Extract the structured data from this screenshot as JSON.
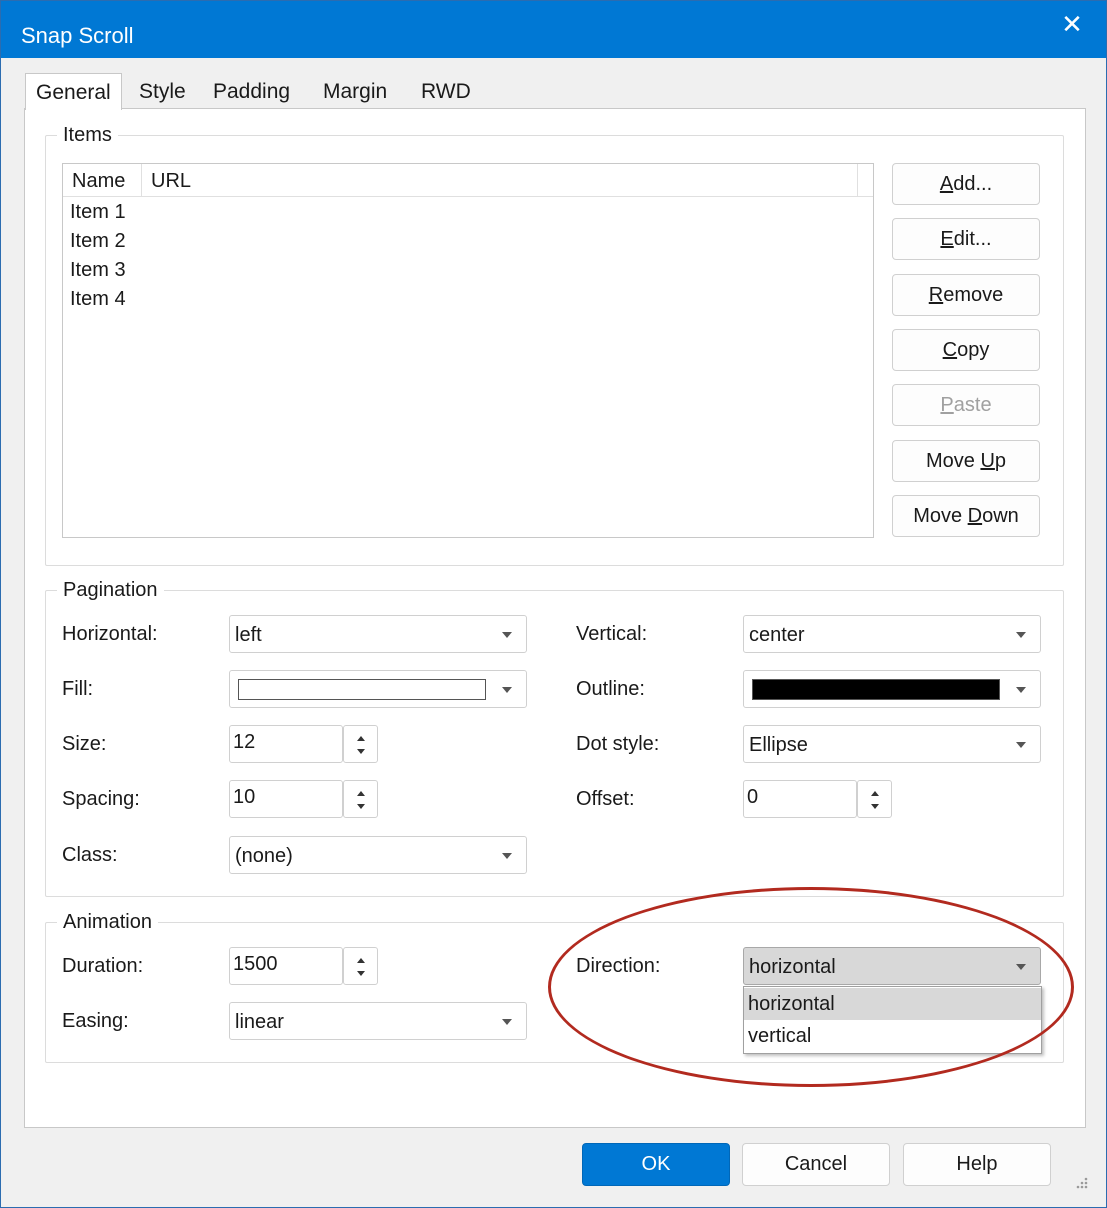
{
  "window": {
    "title": "Snap Scroll",
    "close_glyph": "✕"
  },
  "tabs": [
    {
      "label": "General",
      "active": true
    },
    {
      "label": "Style"
    },
    {
      "label": "Padding"
    },
    {
      "label": "Margin"
    },
    {
      "label": "RWD"
    }
  ],
  "items": {
    "group_label": "Items",
    "columns": [
      "Name",
      "URL"
    ],
    "rows": [
      "Item 1",
      "Item 2",
      "Item 3",
      "Item 4"
    ],
    "buttons": {
      "add": {
        "pre": "",
        "ul": "A",
        "post": "dd..."
      },
      "edit": {
        "pre": "",
        "ul": "E",
        "post": "dit..."
      },
      "remove": {
        "pre": "",
        "ul": "R",
        "post": "emove"
      },
      "copy": {
        "pre": "",
        "ul": "C",
        "post": "opy"
      },
      "paste": {
        "pre": "",
        "ul": "P",
        "post": "aste"
      },
      "move_up": {
        "pre": "Move ",
        "ul": "U",
        "post": "p"
      },
      "move_down": {
        "pre": "Move ",
        "ul": "D",
        "post": "own"
      }
    }
  },
  "pagination": {
    "group_label": "Pagination",
    "horizontal_label": "Horizontal:",
    "horizontal_value": "left",
    "vertical_label": "Vertical:",
    "vertical_value": "center",
    "fill_label": "Fill:",
    "fill_color": "#ffffff",
    "outline_label": "Outline:",
    "outline_color": "#000000",
    "size_label": "Size:",
    "size_value": "12",
    "dot_style_label": "Dot style:",
    "dot_style_value": "Ellipse",
    "spacing_label": "Spacing:",
    "spacing_value": "10",
    "offset_label": "Offset:",
    "offset_value": "0",
    "class_label": "Class:",
    "class_value": "(none)"
  },
  "animation": {
    "group_label": "Animation",
    "duration_label": "Duration:",
    "duration_value": "1500",
    "easing_label": "Easing:",
    "easing_value": "linear",
    "direction_label": "Direction:",
    "direction_value": "horizontal",
    "direction_options": [
      "horizontal",
      "vertical"
    ]
  },
  "footer": {
    "ok": "OK",
    "cancel": "Cancel",
    "help": "Help"
  },
  "colors": {
    "accent": "#0078d4",
    "annotation": "#b22a1f"
  }
}
